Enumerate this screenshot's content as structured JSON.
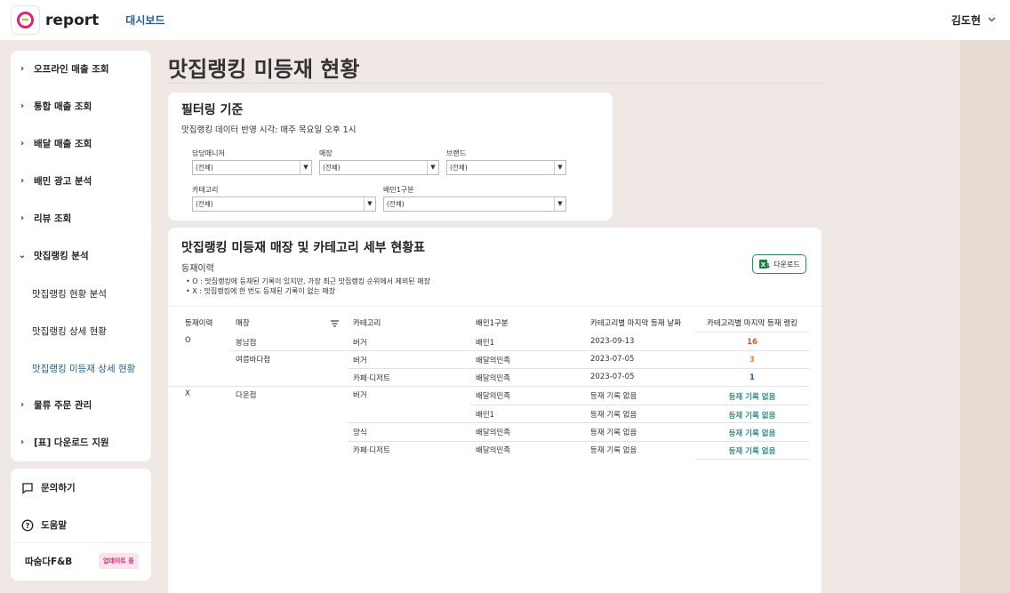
{
  "header": {
    "brand": "report",
    "nav_dashboard": "대시보드",
    "user_name": "김도현",
    "logo_colors": {
      "ring": "#e0207a",
      "bar": "#f2a21a"
    }
  },
  "sidebar": {
    "items": [
      {
        "label": "오프라인 매출 조회",
        "expanded": false
      },
      {
        "label": "통합 매출 조회",
        "expanded": false
      },
      {
        "label": "배달 매출 조회",
        "expanded": false
      },
      {
        "label": "배민 광고 분석",
        "expanded": false
      },
      {
        "label": "리뷰 조회",
        "expanded": false
      },
      {
        "label": "맛집랭킹 분석",
        "expanded": true
      },
      {
        "label": "물류 주문 관리",
        "expanded": false
      },
      {
        "label": "[표] 다운로드 지원",
        "expanded": false
      }
    ],
    "subitems": [
      {
        "label": "맛집랭킹 현황 분석",
        "active": false
      },
      {
        "label": "맛집랭킹 상세 현황",
        "active": false
      },
      {
        "label": "맛집랭킹 미등재 상세 현황",
        "active": true
      }
    ],
    "active_color": "#2a5e89"
  },
  "sidebar_footer": {
    "inquiry": "문의하기",
    "help": "도움말",
    "company": "따숨다F&B",
    "update_badge": "업데이트 중"
  },
  "page": {
    "title": "맛집랭킹 미등재 현황"
  },
  "filter": {
    "title": "필터링 기준",
    "note": "맛집랭킹 데이터 반영 시각: 매주 목요일 오후 1시",
    "fields": {
      "manager": {
        "label": "담당매니저",
        "value": "(전체)"
      },
      "store": {
        "label": "매장",
        "value": "(전체)"
      },
      "brand": {
        "label": "브랜드",
        "value": "(전체)"
      },
      "category": {
        "label": "카테고리",
        "value": "(전체)"
      },
      "baemin_type": {
        "label": "배민1구분",
        "value": "(전체)"
      }
    }
  },
  "table_section": {
    "title": "맛집랭킹 미등재 매장 및 카테고리 세부 현황표",
    "sub_label": "등재이력",
    "legend": [
      "O : 맛집랭킹에 등재된 기록이 있지만, 가장 최근 맛집랭킹 순위에서 제외된 매장",
      "X : 맛집랭킹에 한 번도 등재된 기록이 없는 매장"
    ],
    "download_label": "다운로드",
    "columns": [
      "등재이력",
      "매장",
      "카테고리",
      "배민1구분",
      "카테고리별 마지막 등재 날짜",
      "카테고리별 마지막 등재 랭킹"
    ],
    "rows": [
      {
        "history": "O",
        "store": "봉남점",
        "category": "버거",
        "type": "배민1",
        "date": "2023-09-13",
        "rank": "16",
        "rank_color": "#d9532b"
      },
      {
        "history": "",
        "store": "여름바다점",
        "category": "버거",
        "type": "배달의민족",
        "date": "2023-07-05",
        "rank": "3",
        "rank_color": "#e08a1e"
      },
      {
        "history": "",
        "store": "",
        "category": "카페·디저트",
        "type": "배달의민족",
        "date": "2023-07-05",
        "rank": "1",
        "rank_color": "#2a5e89"
      },
      {
        "history": "X",
        "store": "다운점",
        "category": "버거",
        "type": "배달의민족",
        "date": "등재 기록 없음",
        "rank": "등재 기록 없음",
        "rank_color": "#3a8a86"
      },
      {
        "history": "",
        "store": "",
        "category": "",
        "type": "배민1",
        "date": "등재 기록 없음",
        "rank": "등재 기록 없음",
        "rank_color": "#3a8a86"
      },
      {
        "history": "",
        "store": "",
        "category": "양식",
        "type": "배달의민족",
        "date": "등재 기록 없음",
        "rank": "등재 기록 없음",
        "rank_color": "#3a8a86"
      },
      {
        "history": "",
        "store": "",
        "category": "카페·디저트",
        "type": "배달의민족",
        "date": "등재 기록 없음",
        "rank": "등재 기록 없음",
        "rank_color": "#3a8a86"
      }
    ]
  }
}
